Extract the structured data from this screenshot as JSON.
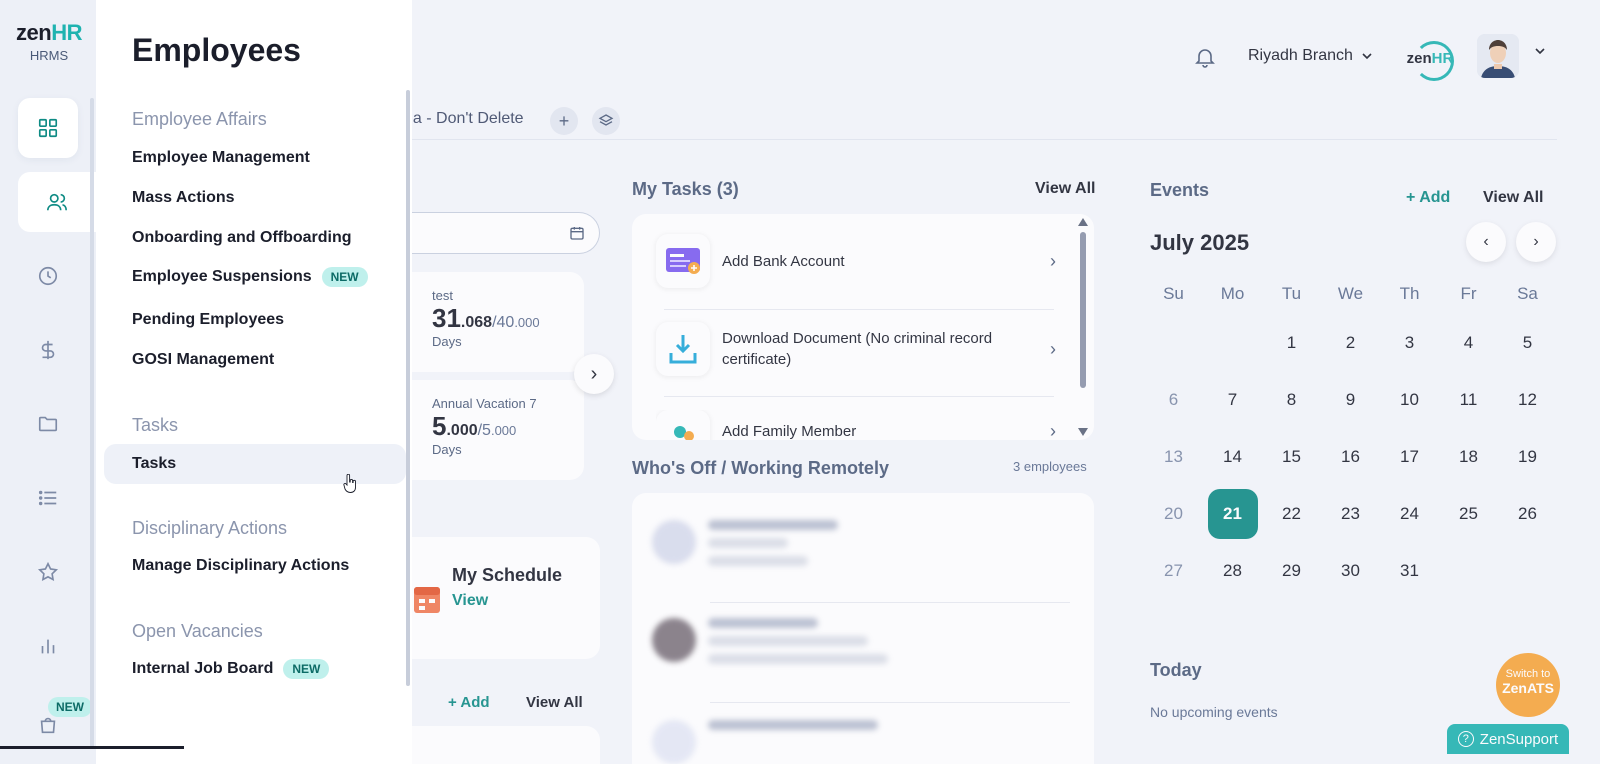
{
  "brand": {
    "logo_prefix": "zen",
    "logo_suffix": "HR",
    "product": "HRMS"
  },
  "rail": {
    "items": [
      {
        "icon": "dashboard-icon"
      },
      {
        "icon": "users-icon"
      },
      {
        "icon": "clock-icon"
      },
      {
        "icon": "dollar-icon"
      },
      {
        "icon": "folder-icon"
      },
      {
        "icon": "list-icon"
      },
      {
        "icon": "star-icon"
      },
      {
        "icon": "bar-chart-icon"
      },
      {
        "icon": "bag-icon"
      }
    ],
    "new_badge": "NEW"
  },
  "header": {
    "branch": "Riyadh Branch",
    "company_logo_prefix": "zen",
    "company_logo_suffix": "HR"
  },
  "tabs": {
    "partial_tab": "na - Don't Delete",
    "add_symbol": "+"
  },
  "panel": {
    "title": "Employees",
    "groups": [
      {
        "label": "Employee Affairs",
        "items": [
          {
            "label": "Employee Management"
          },
          {
            "label": "Mass Actions"
          },
          {
            "label": "Onboarding and Offboarding"
          },
          {
            "label": "Employee Suspensions",
            "badge": "NEW"
          },
          {
            "label": "Pending Employees"
          },
          {
            "label": "GOSI Management"
          }
        ]
      },
      {
        "label": "Tasks",
        "items": [
          {
            "label": "Tasks"
          }
        ]
      },
      {
        "label": "Disciplinary Actions",
        "items": [
          {
            "label": "Manage Disciplinary Actions"
          }
        ]
      },
      {
        "label": "Open Vacancies",
        "items": [
          {
            "label": "Internal Job Board",
            "badge": "NEW"
          }
        ]
      }
    ]
  },
  "balances": [
    {
      "name": "test",
      "value_int": "31",
      "value_dec": ".068",
      "of_int": "/40",
      "of_dec": ".000",
      "unit": "Days"
    },
    {
      "name": "Annual Vacation 7",
      "value_int": "5",
      "value_dec": ".000",
      "of_int": "/5",
      "of_dec": ".000",
      "unit": "Days"
    }
  ],
  "schedule": {
    "title": "My Schedule",
    "link": "View"
  },
  "bottom_links": {
    "add": "+ Add",
    "view_all": "View All"
  },
  "my_tasks": {
    "title": "My Tasks (3)",
    "view_all": "View All",
    "items": [
      {
        "label": "Add Bank Account",
        "icon": "bank-card-icon"
      },
      {
        "label": "Download Document (No criminal record certificate)",
        "icon": "download-icon"
      },
      {
        "label": "Add Family Member",
        "icon": "family-icon"
      }
    ]
  },
  "whos_off": {
    "title": "Who's Off / Working Remotely",
    "count": "3 employees"
  },
  "events": {
    "title": "Events",
    "add": "+ Add",
    "view_all": "View All",
    "month": "July 2025",
    "weekdays": [
      "Su",
      "Mo",
      "Tu",
      "We",
      "Th",
      "Fr",
      "Sa"
    ],
    "first_weekday_index": 2,
    "days_in_month": 31,
    "selected_day": 21,
    "today_title": "Today",
    "no_events": "No upcoming events"
  },
  "switch_ats": {
    "line1": "Switch to",
    "line2": "ZenATS"
  },
  "support": {
    "label": "ZenSupport",
    "icon_text": "?"
  },
  "colors": {
    "accent": "#0e8b84",
    "brand_teal": "#1fb3b0",
    "ats_orange": "#f8a53b",
    "badge_bg": "#bff0ec"
  }
}
